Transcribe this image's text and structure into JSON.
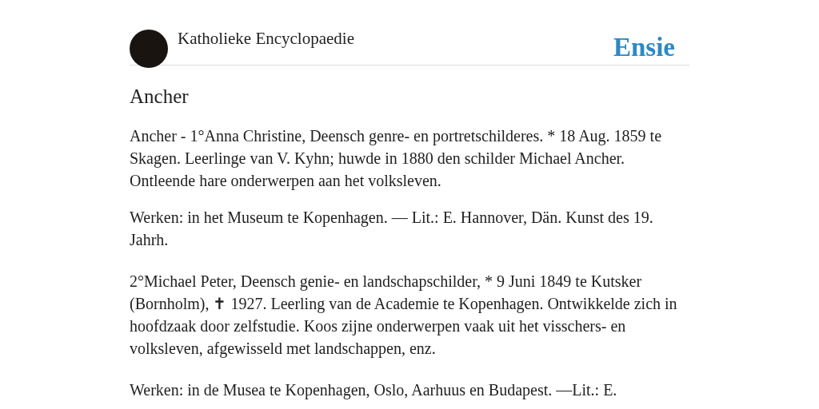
{
  "header": {
    "site_name": "Katholieke Encyclopaedie",
    "logo": "Ensie"
  },
  "article": {
    "title": "Ancher",
    "paragraphs": [
      "Ancher - 1°Anna Christine, Deensch genre- en portretschilderes. * 18 Aug. 1859 te Skagen. Leerlinge van V. Kyhn; huwde in 1880 den schilder Michael Ancher. Ontleende hare onderwerpen aan het volksleven.",
      "Werken: in het Museum te Kopenhagen. — Lit.: E. Hannover, Dän. Kunst des 19. Jahrh.",
      "2°Michael Peter, Deensch genie- en landschapschilder, * 9 Juni 1849 te Kutsker (Bornholm), ✝ 1927. Leerling van de Academie te Kopenhagen. Ontwikkelde zich in hoofdzaak door zelfstudie. Koos zijne onderwerpen vaak uit het visschers- en volksleven, afgewisseld met landschappen, enz.",
      "Werken: in de Musea te Kopenhagen, Oslo, Aarhuus en Budapest. —Lit.: E."
    ]
  }
}
